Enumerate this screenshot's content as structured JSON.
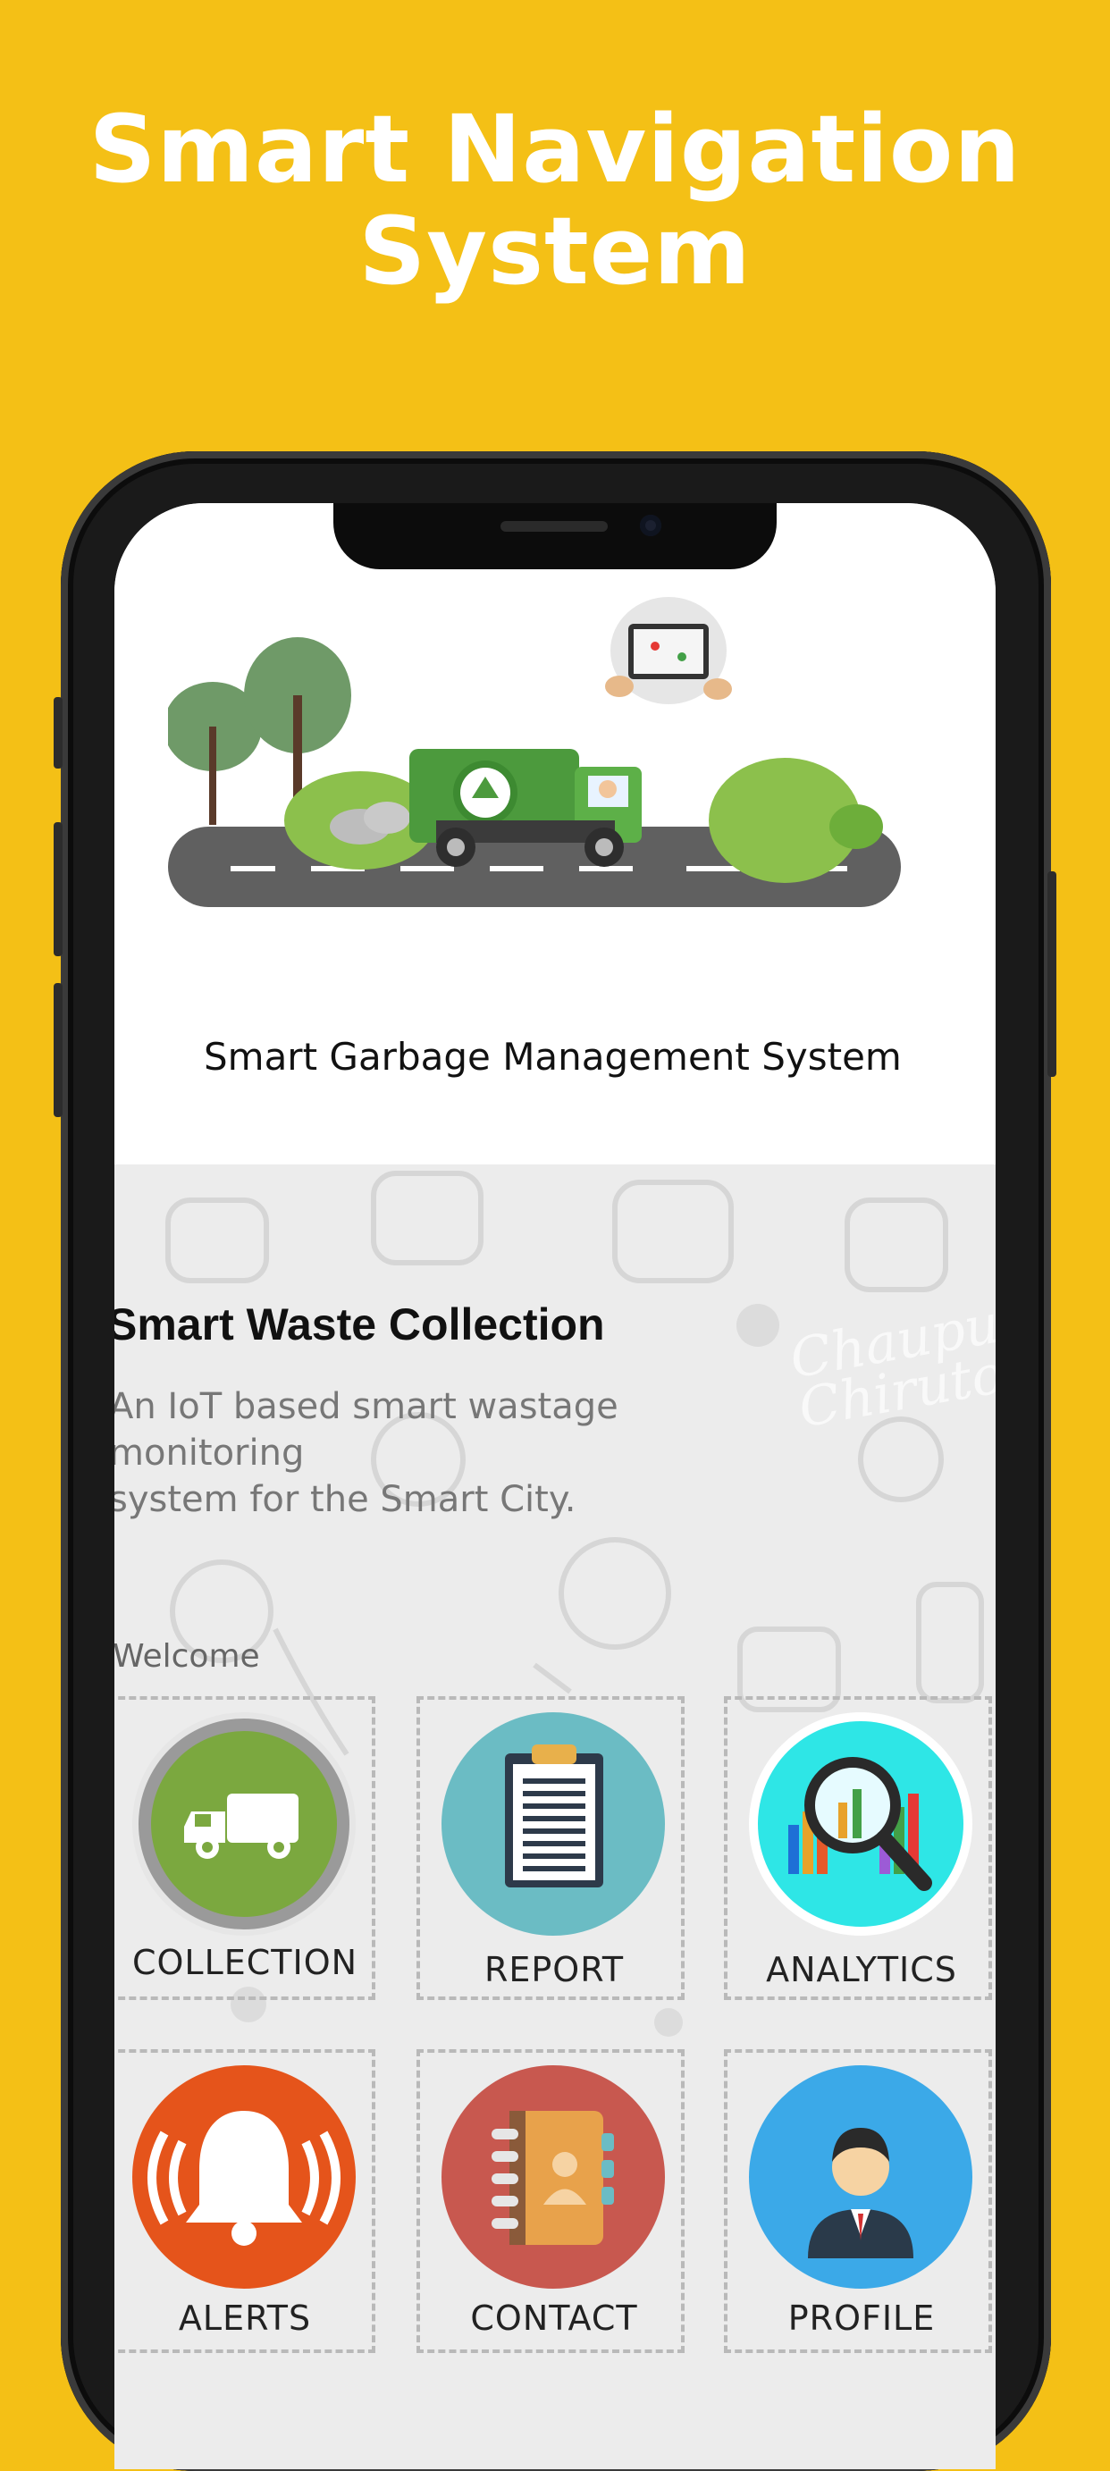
{
  "promo": {
    "title_line1": "Smart Navigation",
    "title_line2": "System"
  },
  "header": {
    "title": "Smart Garbage Management System"
  },
  "hero": {
    "title": "Smart Waste Collection",
    "description_line1": "An IoT based smart wastage monitoring",
    "description_line2": "system for the Smart City.",
    "watermark": "Chaupu Chiruto"
  },
  "welcome": "Welcome",
  "menu": [
    {
      "label": "COLLECTION",
      "icon": "truck-icon",
      "color": "#7BA83F"
    },
    {
      "label": "REPORT",
      "icon": "clipboard-icon",
      "color": "#6BBCC4"
    },
    {
      "label": "ANALYTICS",
      "icon": "magnifier-chart-icon",
      "color": "#2EE6E6"
    },
    {
      "label": "ALERTS",
      "icon": "bell-icon",
      "color": "#E5541B"
    },
    {
      "label": "CONTACT",
      "icon": "address-book-icon",
      "color": "#C8584F"
    },
    {
      "label": "PROFILE",
      "icon": "user-icon",
      "color": "#3BA9E8"
    }
  ],
  "colors": {
    "background": "#F4C016",
    "content_bg": "#ECECEC"
  }
}
